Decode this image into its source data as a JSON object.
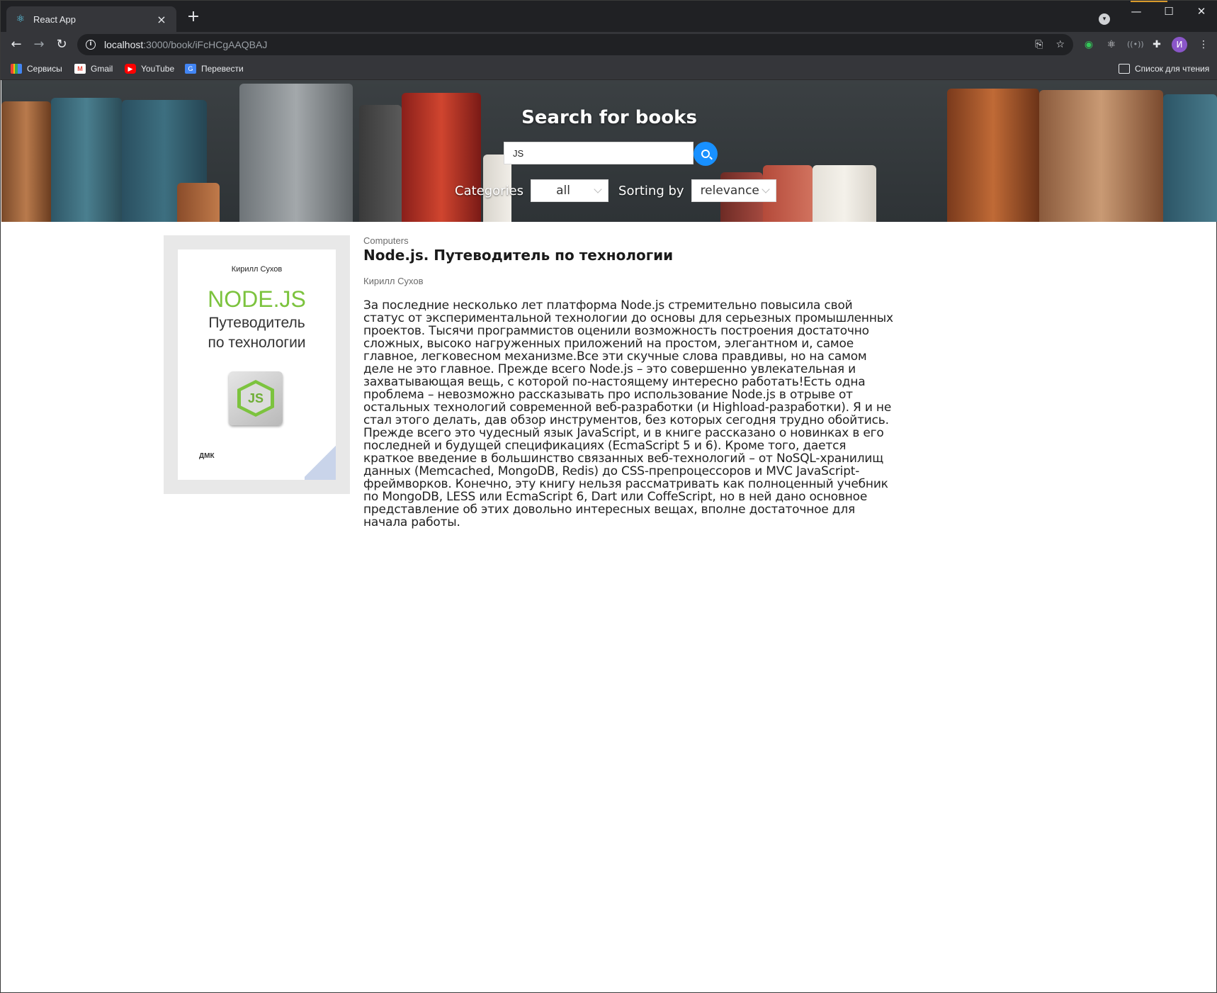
{
  "browser": {
    "tab_title": "React App",
    "tab_close": "×",
    "new_tab": "+",
    "url_host": "localhost",
    "url_path": ":3000/book/iFcHCgAAQBAJ",
    "avatar_letter": "И",
    "window_controls": [
      "—",
      "☐",
      "✕"
    ],
    "bookmarks": [
      {
        "label": "Сервисы",
        "icon": "apps-grid-icon"
      },
      {
        "label": "Gmail",
        "icon": "gmail-icon"
      },
      {
        "label": "YouTube",
        "icon": "youtube-icon"
      },
      {
        "label": "Перевести",
        "icon": "translate-icon"
      }
    ],
    "reading_list": "Список для чтения"
  },
  "hero": {
    "title": "Search for books",
    "search_value": "JS",
    "categories_label": "Categories",
    "category_value": "all",
    "sorting_label": "Sorting by",
    "sorting_value": "relevance",
    "search_button_color": "#1890ff"
  },
  "book": {
    "category": "Computers",
    "title": "Node.js. Путеводитель по технологии",
    "authors": "Кирилл Сухов",
    "description": "За последние несколько лет платформа Node.js стремительно повысила свой статус от экспериментальной технологии до основы для серьезных промышленных проектов. Тысячи программистов оценили возможность построения достаточно сложных, высоко нагруженных приложений на простом, элегантном и, самое главное, легковесном механизме.Все эти скучные слова правдивы, но на самом деле не это главное. Прежде всего Node.js – это совершенно увлекательная и захватывающая вещь, с которой по-настоящему интересно работать!Есть одна проблема – невозможно рассказывать про использование Node.js в отрыве от остальных технологий современной веб-разработки (и Highload-разработки). Я и не стал этого делать, дав обзор инструментов, без которых сегодня трудно обойтись. Прежде всего это чудесный язык JavaScript, и в книге рассказано о новинках в его последней и будущей спецификациях (EcmaScript 5 и 6). Кроме того, дается краткое введение в большинство связанных веб-технологий – от NoSQL-хранилищ данных (Memcached, MongoDB, Redis) до CSS-препроцессоров и MVC JavaScript-фреймворков. Конечно, эту книгу нельзя рассматривать как полноценный учебник по MongoDB, LESS или EcmaScript 6, Dart или CoffeScript, но в ней дано основное представление об этих довольно интересных вещах, вполне достаточное для начала работы.",
    "cover": {
      "author": "Кирилл Сухов",
      "brand": "NODE.JS",
      "subtitle_line1": "Путеводитель",
      "subtitle_line2": "по технологии",
      "logo_text": "JS",
      "publisher": "ДМК",
      "brand_color": "#7cc33e"
    }
  }
}
